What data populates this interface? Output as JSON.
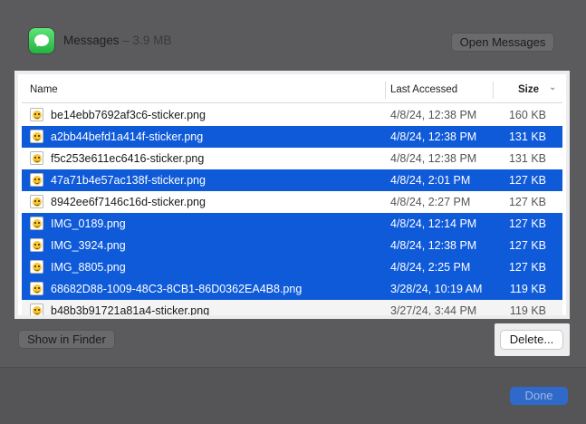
{
  "app": {
    "name": "Messages",
    "size": "– 3.9 MB",
    "open_button": "Open Messages",
    "icon": "messages-app-icon"
  },
  "table": {
    "columns": {
      "name": "Name",
      "last_accessed": "Last Accessed",
      "size": "Size"
    },
    "sort_icon": "chevron-down-icon",
    "rows": [
      {
        "name": "be14ebb7692af3c6-sticker.png",
        "accessed": "4/8/24, 12:38 PM",
        "size": "160 KB",
        "selected": false
      },
      {
        "name": "a2bb44befd1a414f-sticker.png",
        "accessed": "4/8/24, 12:38 PM",
        "size": "131 KB",
        "selected": true
      },
      {
        "name": "f5c253e611ec6416-sticker.png",
        "accessed": "4/8/24, 12:38 PM",
        "size": "131 KB",
        "selected": false
      },
      {
        "name": "47a71b4e57ac138f-sticker.png",
        "accessed": "4/8/24, 2:01 PM",
        "size": "127 KB",
        "selected": true
      },
      {
        "name": "8942ee6f7146c16d-sticker.png",
        "accessed": "4/8/24, 2:27 PM",
        "size": "127 KB",
        "selected": false
      },
      {
        "name": "IMG_0189.png",
        "accessed": "4/8/24, 12:14 PM",
        "size": "127 KB",
        "selected": true
      },
      {
        "name": "IMG_3924.png",
        "accessed": "4/8/24, 12:38 PM",
        "size": "127 KB",
        "selected": true
      },
      {
        "name": "IMG_8805.png",
        "accessed": "4/8/24, 2:25 PM",
        "size": "127 KB",
        "selected": true
      },
      {
        "name": "68682D88-1009-48C3-8CB1-86D0362EA4B8.png",
        "accessed": "3/28/24, 10:19 AM",
        "size": "119 KB",
        "selected": true
      },
      {
        "name": "b48b3b91721a81a4-sticker.png",
        "accessed": "3/27/24, 3:44 PM",
        "size": "119 KB",
        "selected": false
      }
    ]
  },
  "buttons": {
    "show_in_finder": "Show in Finder",
    "delete": "Delete...",
    "done": "Done"
  },
  "colors": {
    "selection": "#0e5ad9",
    "done_button": "#2f69c9"
  }
}
